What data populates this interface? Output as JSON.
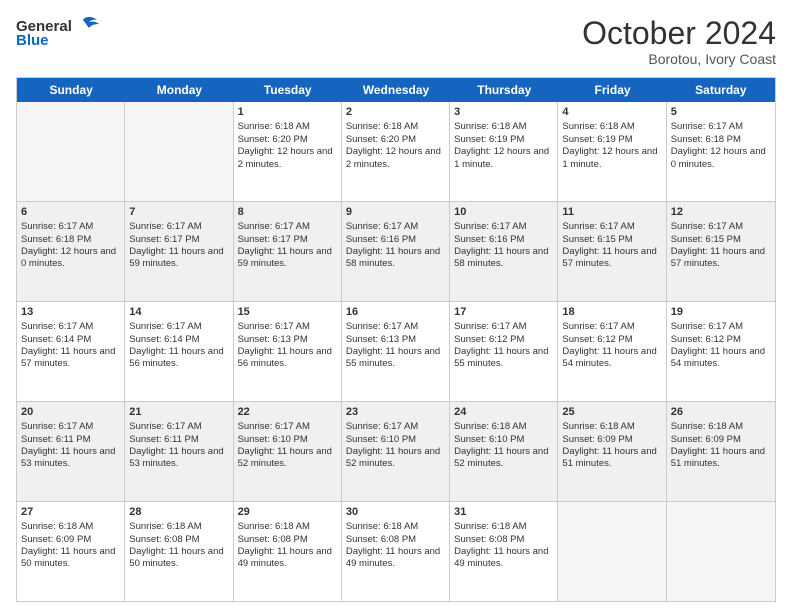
{
  "logo": {
    "line1": "General",
    "line2": "Blue"
  },
  "title": "October 2024",
  "location": "Borotou, Ivory Coast",
  "days_of_week": [
    "Sunday",
    "Monday",
    "Tuesday",
    "Wednesday",
    "Thursday",
    "Friday",
    "Saturday"
  ],
  "weeks": [
    [
      {
        "day": "",
        "info": ""
      },
      {
        "day": "",
        "info": ""
      },
      {
        "day": "1",
        "info": "Sunrise: 6:18 AM\nSunset: 6:20 PM\nDaylight: 12 hours and 2 minutes."
      },
      {
        "day": "2",
        "info": "Sunrise: 6:18 AM\nSunset: 6:20 PM\nDaylight: 12 hours and 2 minutes."
      },
      {
        "day": "3",
        "info": "Sunrise: 6:18 AM\nSunset: 6:19 PM\nDaylight: 12 hours and 1 minute."
      },
      {
        "day": "4",
        "info": "Sunrise: 6:18 AM\nSunset: 6:19 PM\nDaylight: 12 hours and 1 minute."
      },
      {
        "day": "5",
        "info": "Sunrise: 6:17 AM\nSunset: 6:18 PM\nDaylight: 12 hours and 0 minutes."
      }
    ],
    [
      {
        "day": "6",
        "info": "Sunrise: 6:17 AM\nSunset: 6:18 PM\nDaylight: 12 hours and 0 minutes."
      },
      {
        "day": "7",
        "info": "Sunrise: 6:17 AM\nSunset: 6:17 PM\nDaylight: 11 hours and 59 minutes."
      },
      {
        "day": "8",
        "info": "Sunrise: 6:17 AM\nSunset: 6:17 PM\nDaylight: 11 hours and 59 minutes."
      },
      {
        "day": "9",
        "info": "Sunrise: 6:17 AM\nSunset: 6:16 PM\nDaylight: 11 hours and 58 minutes."
      },
      {
        "day": "10",
        "info": "Sunrise: 6:17 AM\nSunset: 6:16 PM\nDaylight: 11 hours and 58 minutes."
      },
      {
        "day": "11",
        "info": "Sunrise: 6:17 AM\nSunset: 6:15 PM\nDaylight: 11 hours and 57 minutes."
      },
      {
        "day": "12",
        "info": "Sunrise: 6:17 AM\nSunset: 6:15 PM\nDaylight: 11 hours and 57 minutes."
      }
    ],
    [
      {
        "day": "13",
        "info": "Sunrise: 6:17 AM\nSunset: 6:14 PM\nDaylight: 11 hours and 57 minutes."
      },
      {
        "day": "14",
        "info": "Sunrise: 6:17 AM\nSunset: 6:14 PM\nDaylight: 11 hours and 56 minutes."
      },
      {
        "day": "15",
        "info": "Sunrise: 6:17 AM\nSunset: 6:13 PM\nDaylight: 11 hours and 56 minutes."
      },
      {
        "day": "16",
        "info": "Sunrise: 6:17 AM\nSunset: 6:13 PM\nDaylight: 11 hours and 55 minutes."
      },
      {
        "day": "17",
        "info": "Sunrise: 6:17 AM\nSunset: 6:12 PM\nDaylight: 11 hours and 55 minutes."
      },
      {
        "day": "18",
        "info": "Sunrise: 6:17 AM\nSunset: 6:12 PM\nDaylight: 11 hours and 54 minutes."
      },
      {
        "day": "19",
        "info": "Sunrise: 6:17 AM\nSunset: 6:12 PM\nDaylight: 11 hours and 54 minutes."
      }
    ],
    [
      {
        "day": "20",
        "info": "Sunrise: 6:17 AM\nSunset: 6:11 PM\nDaylight: 11 hours and 53 minutes."
      },
      {
        "day": "21",
        "info": "Sunrise: 6:17 AM\nSunset: 6:11 PM\nDaylight: 11 hours and 53 minutes."
      },
      {
        "day": "22",
        "info": "Sunrise: 6:17 AM\nSunset: 6:10 PM\nDaylight: 11 hours and 52 minutes."
      },
      {
        "day": "23",
        "info": "Sunrise: 6:17 AM\nSunset: 6:10 PM\nDaylight: 11 hours and 52 minutes."
      },
      {
        "day": "24",
        "info": "Sunrise: 6:18 AM\nSunset: 6:10 PM\nDaylight: 11 hours and 52 minutes."
      },
      {
        "day": "25",
        "info": "Sunrise: 6:18 AM\nSunset: 6:09 PM\nDaylight: 11 hours and 51 minutes."
      },
      {
        "day": "26",
        "info": "Sunrise: 6:18 AM\nSunset: 6:09 PM\nDaylight: 11 hours and 51 minutes."
      }
    ],
    [
      {
        "day": "27",
        "info": "Sunrise: 6:18 AM\nSunset: 6:09 PM\nDaylight: 11 hours and 50 minutes."
      },
      {
        "day": "28",
        "info": "Sunrise: 6:18 AM\nSunset: 6:08 PM\nDaylight: 11 hours and 50 minutes."
      },
      {
        "day": "29",
        "info": "Sunrise: 6:18 AM\nSunset: 6:08 PM\nDaylight: 11 hours and 49 minutes."
      },
      {
        "day": "30",
        "info": "Sunrise: 6:18 AM\nSunset: 6:08 PM\nDaylight: 11 hours and 49 minutes."
      },
      {
        "day": "31",
        "info": "Sunrise: 6:18 AM\nSunset: 6:08 PM\nDaylight: 11 hours and 49 minutes."
      },
      {
        "day": "",
        "info": ""
      },
      {
        "day": "",
        "info": ""
      }
    ]
  ]
}
